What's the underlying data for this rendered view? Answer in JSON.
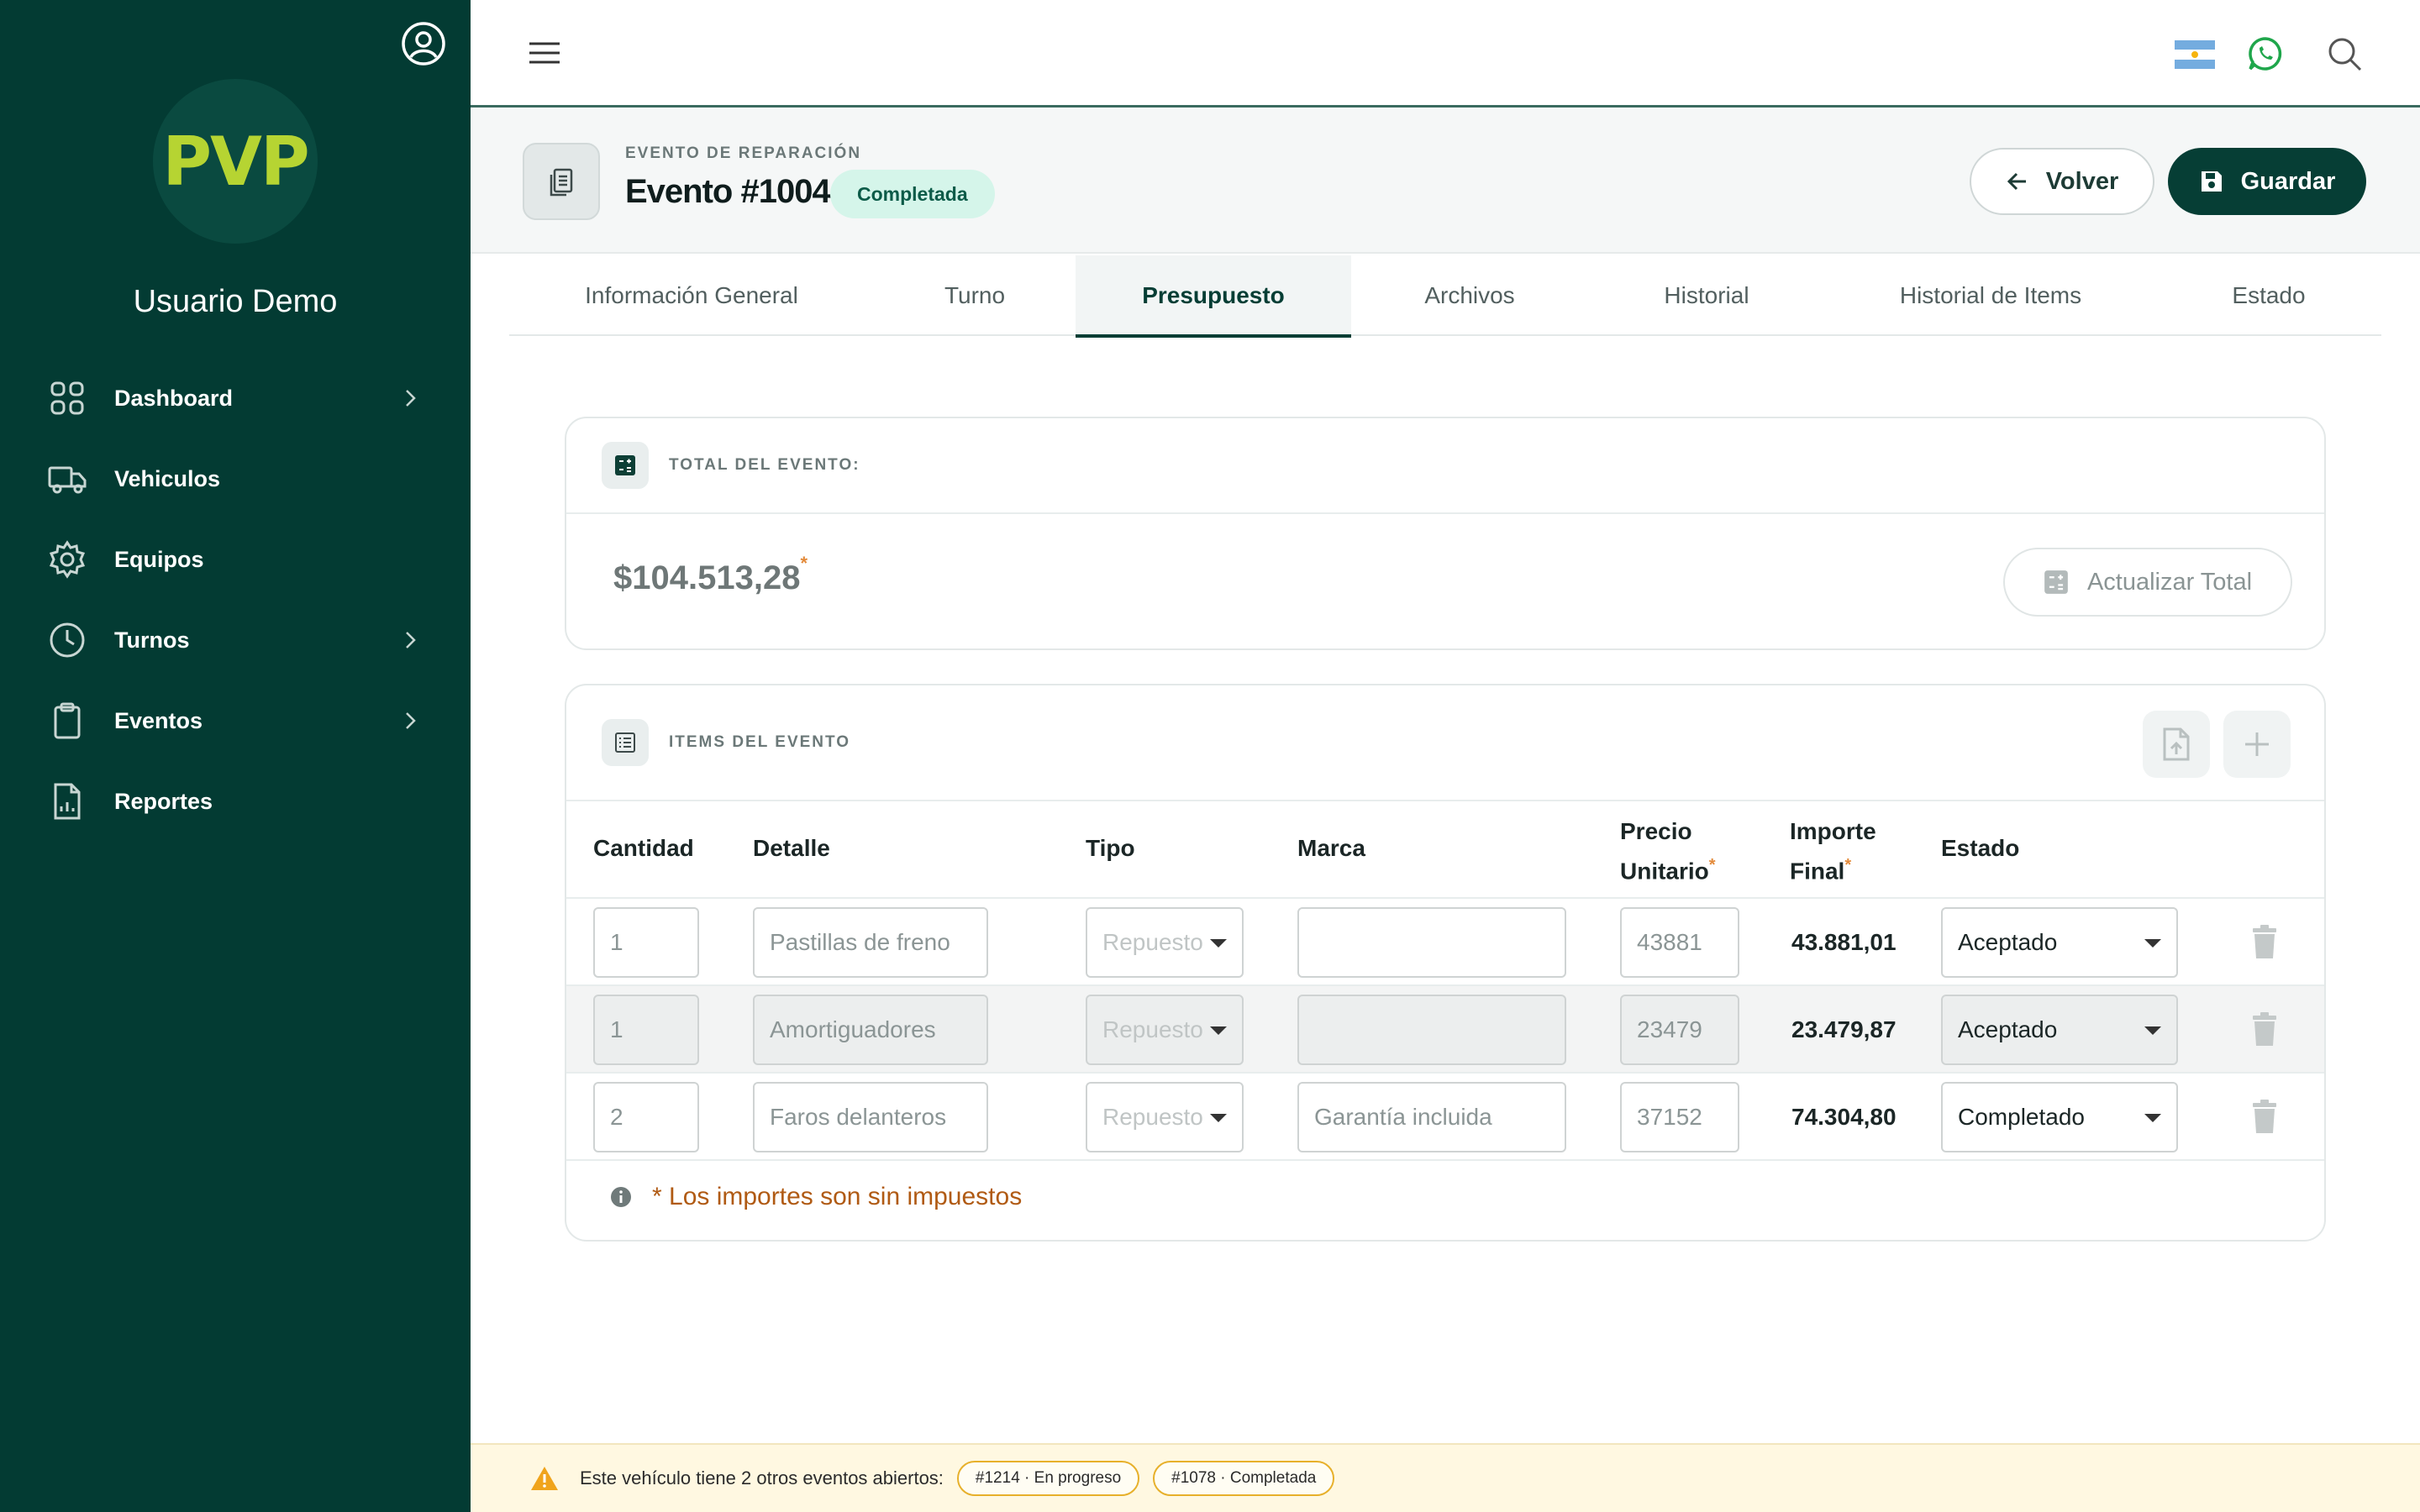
{
  "sidebar": {
    "user_name": "Usuario Demo",
    "logo_text": "PVP",
    "items": [
      {
        "label": "Dashboard",
        "icon": "grid-icon",
        "has_chevron": true
      },
      {
        "label": "Vehiculos",
        "icon": "truck-icon",
        "has_chevron": false
      },
      {
        "label": "Equipos",
        "icon": "gear-icon",
        "has_chevron": false
      },
      {
        "label": "Turnos",
        "icon": "clock-icon",
        "has_chevron": true
      },
      {
        "label": "Eventos",
        "icon": "clipboard-icon",
        "has_chevron": true
      },
      {
        "label": "Reportes",
        "icon": "report-file-icon",
        "has_chevron": false
      }
    ]
  },
  "header": {
    "kicker": "EVENTO DE REPARACIÓN",
    "title": "Evento #1004",
    "badge": "Completada",
    "back_label": "Volver",
    "save_label": "Guardar"
  },
  "tabs": [
    "Información General",
    "Turno",
    "Presupuesto",
    "Archivos",
    "Historial",
    "Historial de Items",
    "Estado"
  ],
  "active_tab": "Presupuesto",
  "total": {
    "title": "TOTAL DEL EVENTO:",
    "amount": "$104.513,28",
    "asterisk": "*",
    "update_label": "Actualizar Total"
  },
  "items": {
    "title": "ITEMS DEL EVENTO",
    "columns": {
      "cantidad": "Cantidad",
      "detalle": "Detalle",
      "tipo": "Tipo",
      "marca": "Marca",
      "precio_1": "Precio",
      "precio_2": "Unitario",
      "importe_1": "Importe",
      "importe_2": "Final",
      "estado": "Estado",
      "asterisk": "*"
    },
    "rows": [
      {
        "cantidad": "1",
        "detalle": "Pastillas de freno",
        "tipo": "Repuesto",
        "marca": "",
        "precio": "43881",
        "importe": "43.881,01",
        "estado": "Aceptado"
      },
      {
        "cantidad": "1",
        "detalle": "Amortiguadores",
        "tipo": "Repuesto",
        "marca": "",
        "precio": "23479",
        "importe": "23.479,87",
        "estado": "Aceptado"
      },
      {
        "cantidad": "2",
        "detalle": "Faros delanteros",
        "tipo": "Repuesto",
        "marca": "Garantía incluida",
        "precio": "37152",
        "importe": "74.304,80",
        "estado": "Completado"
      }
    ],
    "note": "* Los importes son sin impuestos"
  },
  "banner": {
    "text": "Este vehículo tiene 2 otros eventos abiertos:",
    "chips": [
      "#1214 · En progreso",
      "#1078 · Completada"
    ]
  },
  "colors": {
    "sidebar_bg": "#033b33",
    "accent": "#063e35",
    "logo": "#b6d432",
    "badge_bg": "#d5f5ea",
    "warning": "#e7b02b"
  }
}
